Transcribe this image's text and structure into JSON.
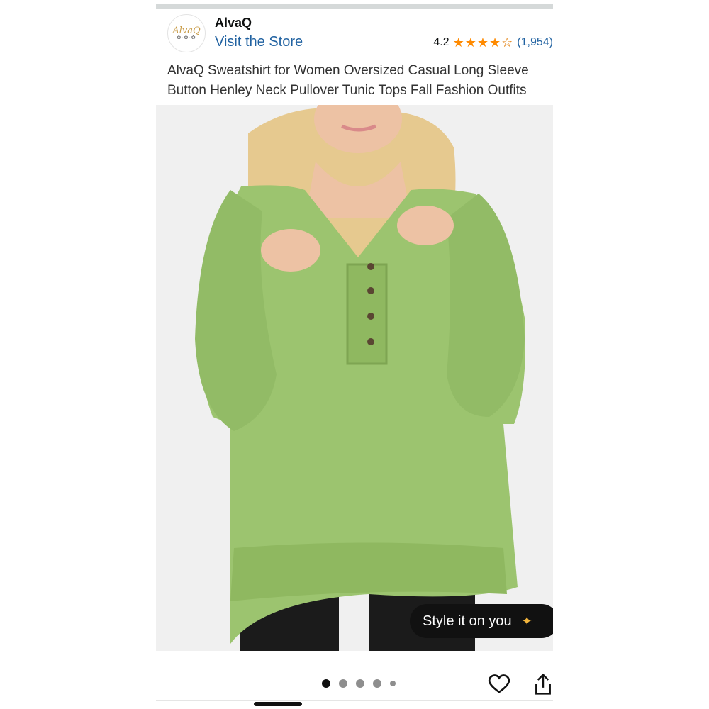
{
  "brand": {
    "logo_text": "AlvaQ",
    "name": "AlvaQ",
    "visit_store": "Visit the Store"
  },
  "rating": {
    "value": "4.2",
    "stars": 4.2,
    "review_count": "(1,954)"
  },
  "product": {
    "title": "AlvaQ Sweatshirt for Women Oversized Casual Long Sleeve Button Henley Neck Pullover Tunic Tops Fall Fashion Outfits",
    "image_alt": "Woman wearing green oversized henley sweatshirt",
    "color": "#9cc46f"
  },
  "style_button": {
    "label": "Style it on you",
    "icon": "sparkle-icon"
  },
  "carousel": {
    "total_dots": 5,
    "active_index": 0
  },
  "actions": {
    "favorite_icon": "heart-icon",
    "share_icon": "share-icon"
  },
  "colors": {
    "link": "#2162a1",
    "star": "#ff8a00",
    "dark_button": "#111111"
  }
}
